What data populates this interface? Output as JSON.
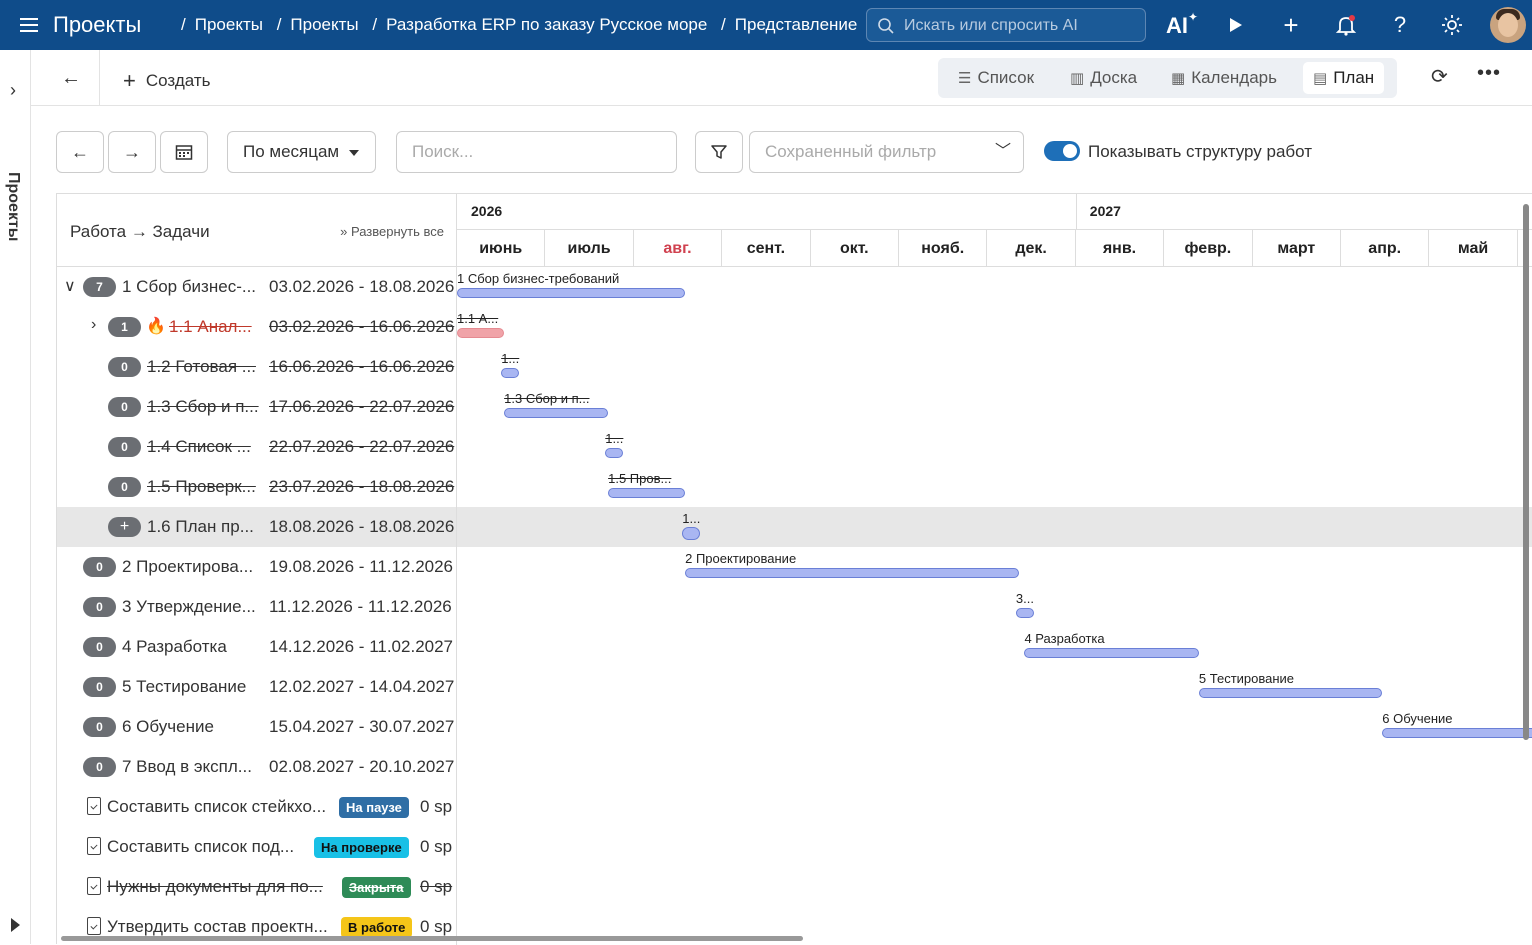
{
  "app": {
    "title": "Проекты"
  },
  "breadcrumbs": [
    "Проекты",
    "Проекты",
    "Разработка ERP по заказу Русское море",
    "Представление"
  ],
  "search": {
    "placeholder": "Искать или спросить AI"
  },
  "topbar": {
    "ai_label": "AI"
  },
  "leftrail": {
    "label": "Проекты"
  },
  "toolbar": {
    "create_label": "Создать",
    "views": [
      {
        "label": "Список",
        "icon": "list-icon"
      },
      {
        "label": "Доска",
        "icon": "board-icon"
      },
      {
        "label": "Календарь",
        "icon": "calendar-icon"
      },
      {
        "label": "План",
        "icon": "gantt-icon",
        "active": true
      }
    ]
  },
  "filters": {
    "period": "По месяцам",
    "search_placeholder": "Поиск...",
    "saved_filter_placeholder": "Сохраненный фильтр",
    "show_structure_label": "Показывать структуру работ",
    "show_structure_on": true
  },
  "table": {
    "header": "Работа → Задачи",
    "expand_all": "Развернуть все",
    "rows": [
      {
        "count": "7",
        "name": "1 Сбор бизнес-...",
        "dates": "03.02.2026 - 18.08.2026"
      },
      {
        "count": "1",
        "name": "1.1 Анал...",
        "dates": "03.02.2026 - 16.06.2026",
        "hot": true
      },
      {
        "count": "0",
        "name": "1.2 Готовая ...",
        "dates": "16.06.2026 - 16.06.2026"
      },
      {
        "count": "0",
        "name": "1.3 Сбор и п...",
        "dates": "17.06.2026 - 22.07.2026"
      },
      {
        "count": "0",
        "name": "1.4 Список ...",
        "dates": "22.07.2026 - 22.07.2026"
      },
      {
        "count": "0",
        "name": "1.5 Проверк...",
        "dates": "23.07.2026 - 18.08.2026"
      },
      {
        "count": "+",
        "name": "1.6 План пр...",
        "dates": "18.08.2026 - 18.08.2026"
      },
      {
        "count": "0",
        "name": "2 Проектирова...",
        "dates": "19.08.2026 - 11.12.2026"
      },
      {
        "count": "0",
        "name": "3 Утверждение...",
        "dates": "11.12.2026 - 11.12.2026"
      },
      {
        "count": "0",
        "name": "4 Разработка",
        "dates": "14.12.2026 - 11.02.2027"
      },
      {
        "count": "0",
        "name": "5 Тестирование",
        "dates": "12.02.2027 - 14.04.2027"
      },
      {
        "count": "0",
        "name": "6 Обучение",
        "dates": "15.04.2027 - 30.07.2027"
      },
      {
        "count": "0",
        "name": "7 Ввод в экспл...",
        "dates": "02.08.2027 - 20.10.2027"
      }
    ],
    "tasks": [
      {
        "name": "Составить список стейкхо...",
        "status": "На паузе",
        "status_color": "#2f6ea5",
        "points": "0 sp"
      },
      {
        "name": "Составить список под...",
        "status": "На проверке",
        "status_color": "#18c0e6",
        "points": "0 sp"
      },
      {
        "name": "Нужны документы для по...",
        "status": "Закрыта",
        "status_color": "#2e8b57",
        "points": "0 sp"
      },
      {
        "name": "Утвердить состав проектн...",
        "status": "В работе",
        "status_color": "#f5c518",
        "points": "0 sp"
      }
    ]
  },
  "timeline": {
    "years": [
      "2026",
      "2027"
    ],
    "months": [
      "июнь",
      "июль",
      "авг.",
      "сент.",
      "окт.",
      "нояб.",
      "дек.",
      "янв.",
      "февр.",
      "март",
      "апр.",
      "май"
    ],
    "current_month": "авг.",
    "bars": [
      {
        "label": "1 Сбор бизнес-требований",
        "start": "2026-02-03",
        "end": "2026-08-18"
      },
      {
        "label": "1.1 А...",
        "start": "2026-02-03",
        "end": "2026-06-16",
        "color": "red"
      },
      {
        "label": "1...",
        "start": "2026-06-16",
        "end": "2026-06-16"
      },
      {
        "label": "1.3 Сбор и п...",
        "start": "2026-06-17",
        "end": "2026-07-22"
      },
      {
        "label": "1...",
        "start": "2026-07-22",
        "end": "2026-07-22"
      },
      {
        "label": "1.5 Пров...",
        "start": "2026-07-23",
        "end": "2026-08-18"
      },
      {
        "label": "1...",
        "start": "2026-08-18",
        "end": "2026-08-18"
      },
      {
        "label": "2 Проектирование",
        "start": "2026-08-19",
        "end": "2026-12-11"
      },
      {
        "label": "3...",
        "start": "2026-12-11",
        "end": "2026-12-11"
      },
      {
        "label": "4 Разработка",
        "start": "2026-12-14",
        "end": "2027-02-11"
      },
      {
        "label": "5 Тестирование",
        "start": "2027-02-12",
        "end": "2027-04-14"
      },
      {
        "label": "6 Обучение",
        "start": "2027-04-15",
        "end": "2027-07-30"
      }
    ]
  }
}
